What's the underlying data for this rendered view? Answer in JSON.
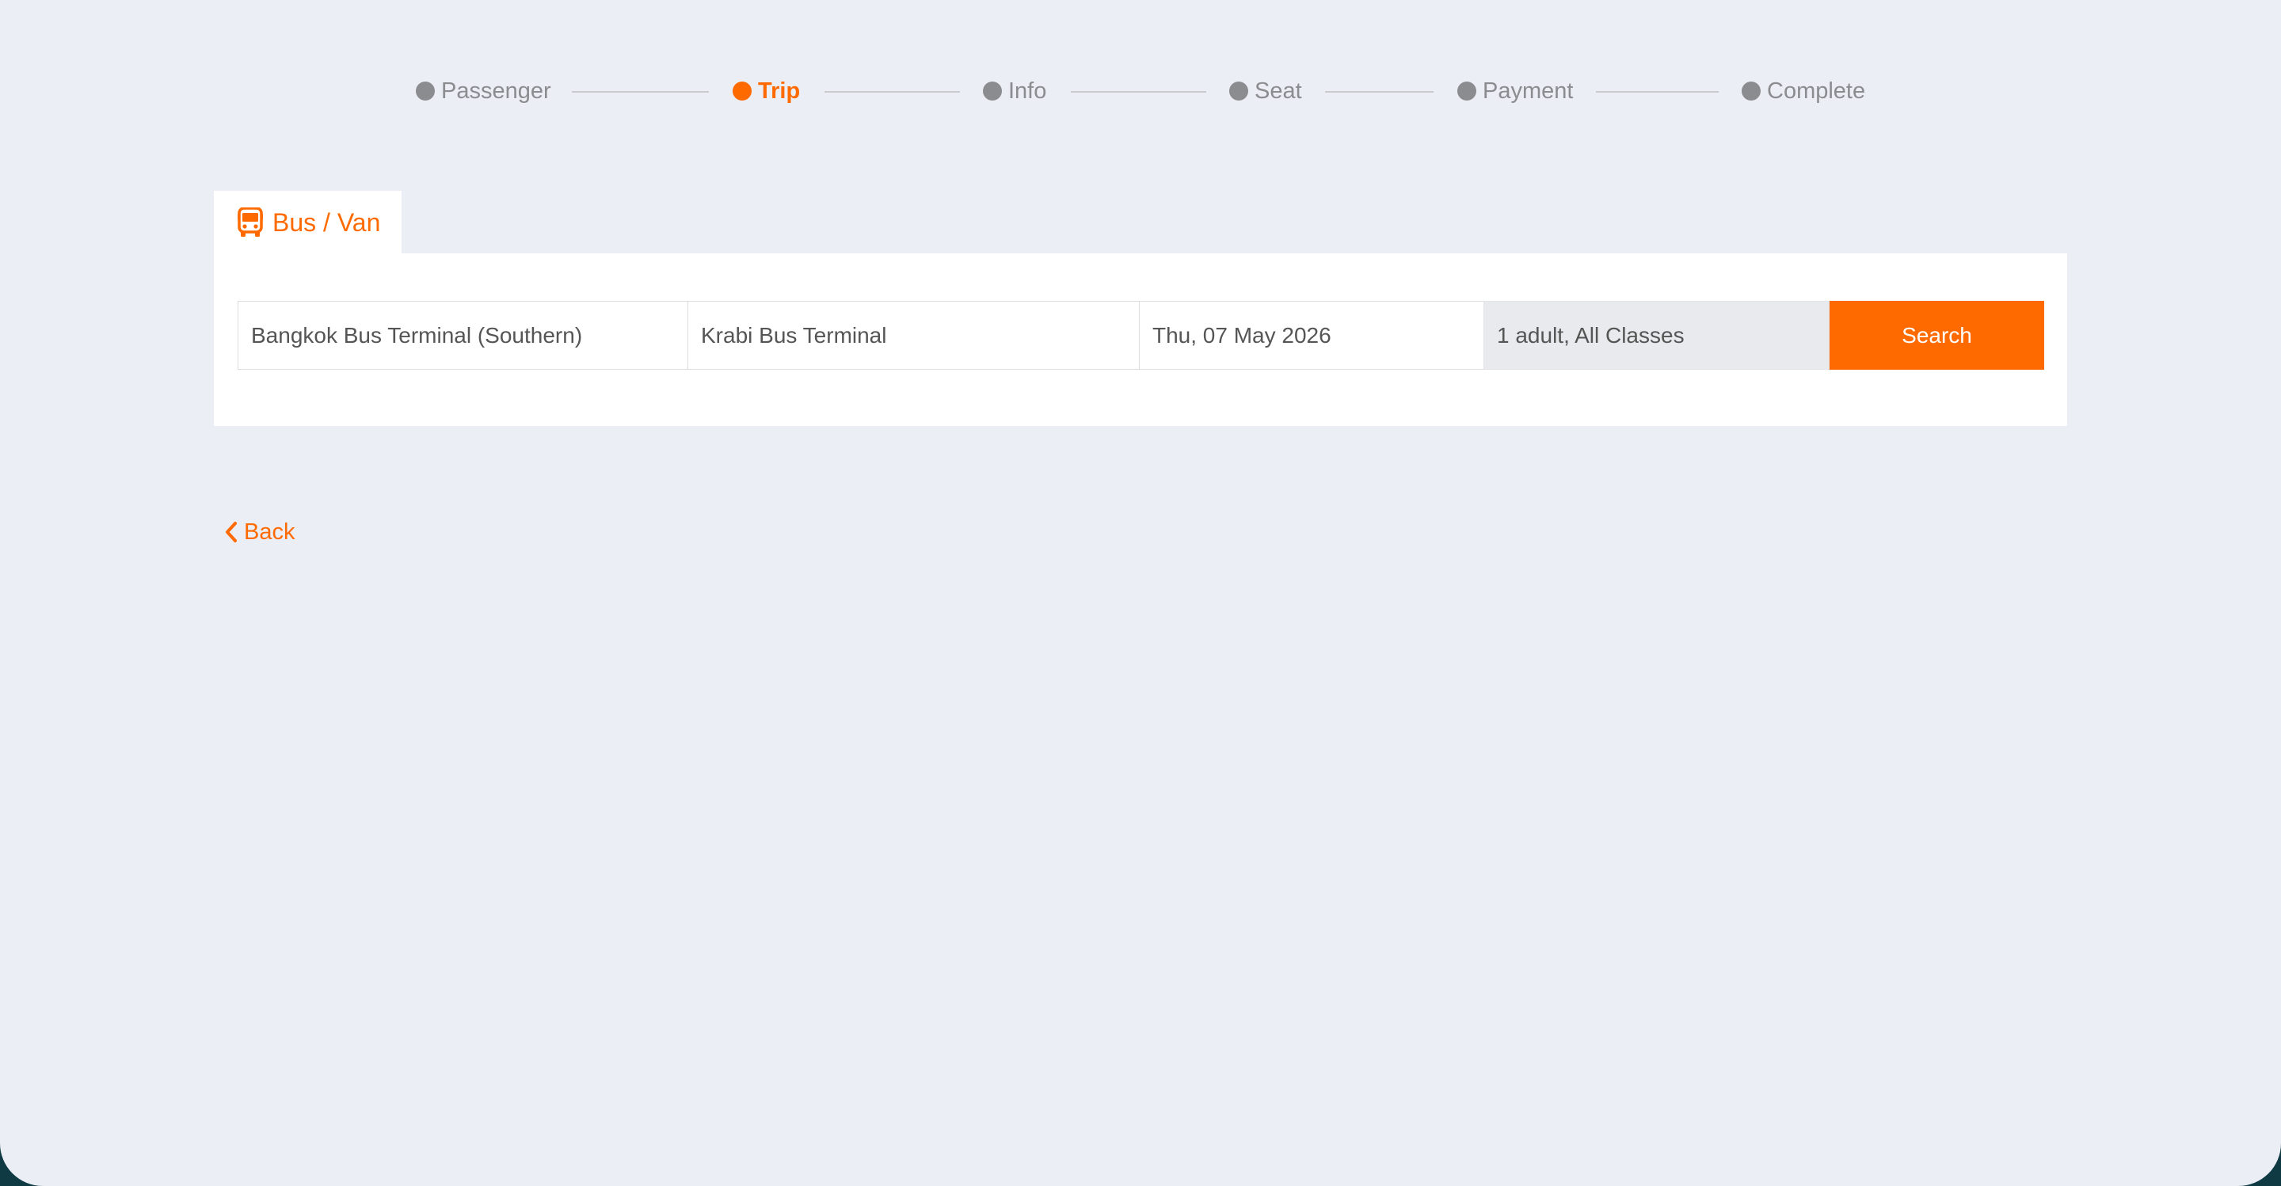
{
  "stepper": {
    "steps": [
      {
        "label": "Passenger",
        "active": false
      },
      {
        "label": "Trip",
        "active": true
      },
      {
        "label": "Info",
        "active": false
      },
      {
        "label": "Seat",
        "active": false
      },
      {
        "label": "Payment",
        "active": false
      },
      {
        "label": "Complete",
        "active": false
      }
    ]
  },
  "tab": {
    "icon": "bus-icon",
    "label": "Bus / Van"
  },
  "search": {
    "origin": "Bangkok Bus Terminal (Southern)",
    "destination": "Krabi Bus Terminal",
    "date": "Thu, 07 May 2026",
    "passengers": "1 adult, All Classes",
    "button_label": "Search"
  },
  "back": {
    "icon": "chevron-left-icon",
    "label": "Back"
  },
  "colors": {
    "accent": "#ff6a00",
    "background": "#ebeef5",
    "inactive": "#8a8c8f"
  }
}
